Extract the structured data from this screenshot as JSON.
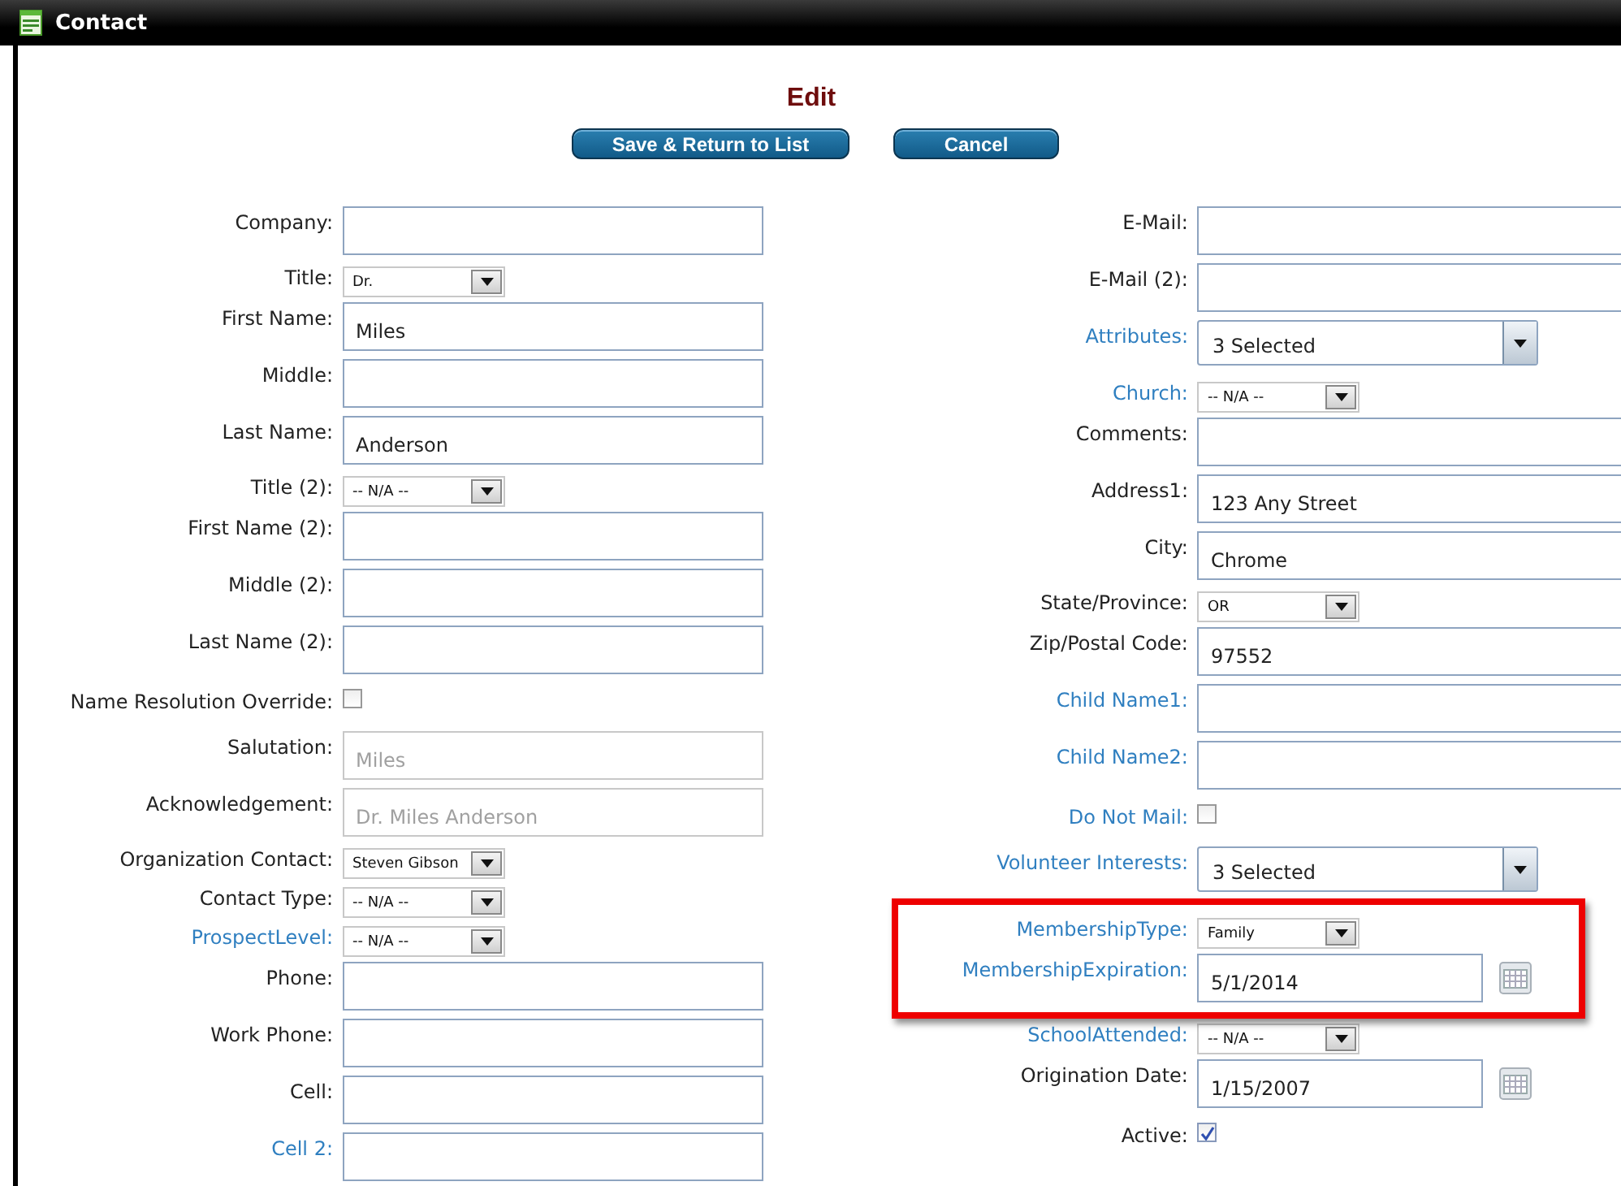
{
  "window": {
    "title": "Contact"
  },
  "heading": "Edit",
  "buttons": [
    {
      "label": "Save & Return to List"
    },
    {
      "label": "Cancel"
    }
  ],
  "left_fields": [
    {
      "label": "Company:",
      "kind": "text",
      "linked": false
    },
    {
      "label": "Title:",
      "kind": "select",
      "value": "Dr.",
      "linked": false
    },
    {
      "label": "First Name:",
      "kind": "text",
      "value": "Miles",
      "linked": false
    },
    {
      "label": "Middle:",
      "kind": "text",
      "linked": false
    },
    {
      "label": "Last Name:",
      "kind": "text",
      "value": "Anderson",
      "linked": false
    },
    {
      "label": "Title (2):",
      "kind": "select",
      "value": "-- N/A --",
      "linked": false
    },
    {
      "label": "First Name (2):",
      "kind": "text",
      "linked": false
    },
    {
      "label": "Middle (2):",
      "kind": "text",
      "linked": false
    },
    {
      "label": "Last Name (2):",
      "kind": "text",
      "linked": false
    },
    {
      "label": "Name Resolution Override:",
      "kind": "checkbox",
      "checked": false,
      "linked": false
    },
    {
      "label": "Salutation:",
      "kind": "text",
      "value": "Miles",
      "disabled": true,
      "linked": false
    },
    {
      "label": "Acknowledgement:",
      "kind": "text",
      "value": "Dr. Miles Anderson",
      "disabled": true,
      "linked": false
    },
    {
      "label": "Organization Contact:",
      "kind": "select",
      "value": "Steven Gibson",
      "linked": false
    },
    {
      "label": "Contact Type:",
      "kind": "select",
      "value": "-- N/A --",
      "linked": false
    },
    {
      "label": "ProspectLevel:",
      "kind": "select",
      "value": "-- N/A --",
      "linked": true
    },
    {
      "label": "Phone:",
      "kind": "text",
      "linked": false
    },
    {
      "label": "Work Phone:",
      "kind": "text",
      "linked": false
    },
    {
      "label": "Cell:",
      "kind": "text",
      "linked": false
    },
    {
      "label": "Cell 2:",
      "kind": "text",
      "linked": true
    }
  ],
  "right_fields": [
    {
      "label": "E-Mail:",
      "kind": "text",
      "linked": false
    },
    {
      "label": "E-Mail (2):",
      "kind": "text",
      "linked": false
    },
    {
      "label": "Attributes:",
      "kind": "multiselect",
      "value": "3 Selected",
      "linked": true
    },
    {
      "label": "Church:",
      "kind": "select",
      "value": "-- N/A --",
      "linked": true
    },
    {
      "label": "Comments:",
      "kind": "text",
      "linked": false
    },
    {
      "label": "Address1:",
      "kind": "text",
      "value": "123 Any Street",
      "linked": false
    },
    {
      "label": "City:",
      "kind": "text",
      "value": "Chrome",
      "linked": false
    },
    {
      "label": "State/Province:",
      "kind": "select",
      "value": "OR",
      "linked": false
    },
    {
      "label": "Zip/Postal Code:",
      "kind": "text",
      "value": "97552",
      "linked": false
    },
    {
      "label": "Child Name1:",
      "kind": "text",
      "linked": true
    },
    {
      "label": "Child Name2:",
      "kind": "text",
      "linked": true
    },
    {
      "label": "Do Not Mail:",
      "kind": "checkbox",
      "checked": false,
      "linked": true
    },
    {
      "label": "Volunteer Interests:",
      "kind": "multiselect",
      "value": "3 Selected",
      "linked": true
    },
    {
      "label": "MembershipType:",
      "kind": "select",
      "value": "Family",
      "linked": true,
      "highlighted": true
    },
    {
      "label": "MembershipExpiration:",
      "kind": "date",
      "value": "5/1/2014",
      "linked": true,
      "highlighted": true
    },
    {
      "label": "SchoolAttended:",
      "kind": "select",
      "value": "-- N/A --",
      "linked": true
    },
    {
      "label": "Origination Date:",
      "kind": "date",
      "value": "1/15/2007",
      "linked": false
    },
    {
      "label": "Active:",
      "kind": "checkbox",
      "checked": true,
      "linked": false
    }
  ]
}
